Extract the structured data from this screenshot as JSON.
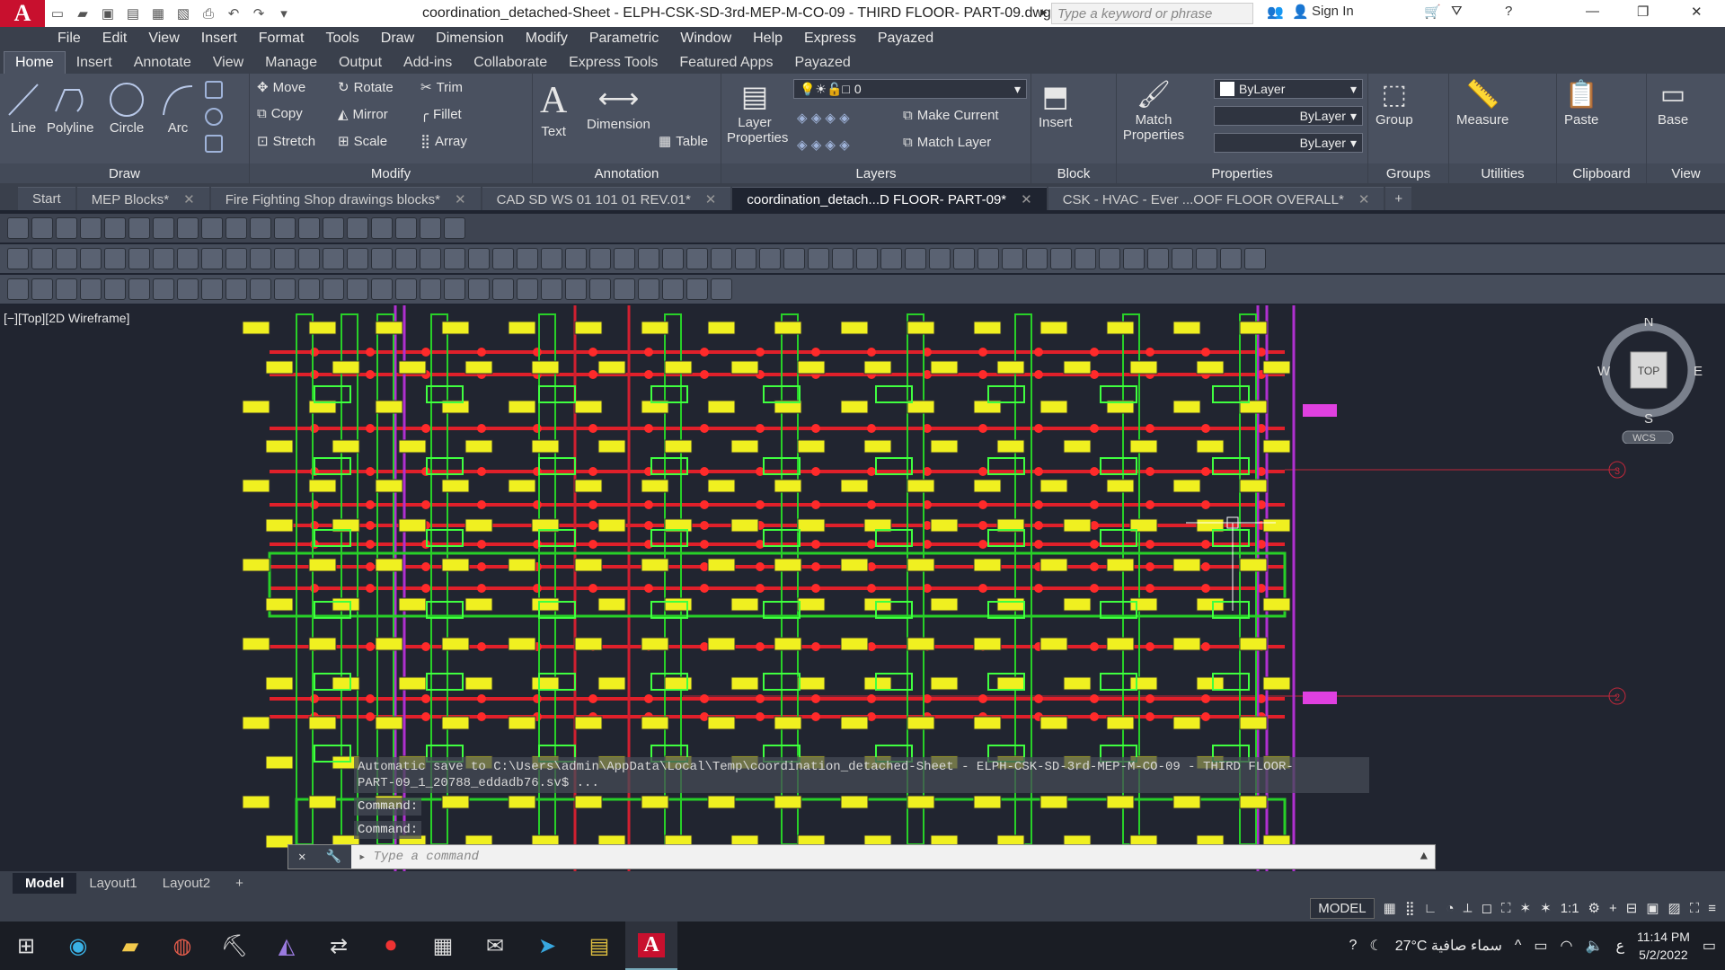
{
  "title_bar": {
    "logo": "A",
    "document_title": "coordination_detached-Sheet - ELPH-CSK-SD-3rd-MEP-M-CO-09 - THIRD  FLOOR- PART-09.dwg",
    "search_placeholder": "Type a keyword or phrase",
    "sign_in": "Sign In"
  },
  "menu": [
    "File",
    "Edit",
    "View",
    "Insert",
    "Format",
    "Tools",
    "Draw",
    "Dimension",
    "Modify",
    "Parametric",
    "Window",
    "Help",
    "Express",
    "Payazed"
  ],
  "ribbon_tabs": [
    "Home",
    "Insert",
    "Annotate",
    "View",
    "Manage",
    "Output",
    "Add-ins",
    "Collaborate",
    "Express Tools",
    "Featured Apps",
    "Payazed"
  ],
  "ribbon": {
    "draw": {
      "label": "Draw",
      "line": "Line",
      "polyline": "Polyline",
      "circle": "Circle",
      "arc": "Arc"
    },
    "modify": {
      "label": "Modify",
      "move": "Move",
      "rotate": "Rotate",
      "trim": "Trim",
      "copy": "Copy",
      "mirror": "Mirror",
      "fillet": "Fillet",
      "stretch": "Stretch",
      "scale": "Scale",
      "array": "Array"
    },
    "annotation": {
      "label": "Annotation",
      "text": "Text",
      "dimension": "Dimension",
      "table": "Table"
    },
    "layers": {
      "label": "Layers",
      "layer_properties": "Layer Properties",
      "current_layer": "0",
      "make_current": "Make Current",
      "match_layer": "Match Layer"
    },
    "block": {
      "label": "Block",
      "insert": "Insert"
    },
    "properties": {
      "label": "Properties",
      "match_properties": "Match Properties",
      "color": "ByLayer",
      "linetype": "ByLayer",
      "lineweight": "ByLayer"
    },
    "groups": {
      "label": "Groups",
      "group": "Group"
    },
    "utilities": {
      "label": "Utilities",
      "measure": "Measure"
    },
    "clipboard": {
      "label": "Clipboard",
      "paste": "Paste"
    },
    "view": {
      "label": "View",
      "base": "Base"
    }
  },
  "doc_tabs": [
    {
      "label": "Start",
      "active": false
    },
    {
      "label": "MEP Blocks*",
      "active": false
    },
    {
      "label": "Fire Fighting Shop drawings blocks*",
      "active": false
    },
    {
      "label": "CAD SD WS 01 101 01 REV.01*",
      "active": false
    },
    {
      "label": "coordination_detach...D  FLOOR- PART-09*",
      "active": true
    },
    {
      "label": "CSK - HVAC - Ever ...OOF FLOOR OVERALL*",
      "active": false
    }
  ],
  "viewport_label": "[−][Top][2D Wireframe]",
  "viewcube": {
    "n": "N",
    "s": "S",
    "e": "E",
    "w": "W",
    "top": "TOP",
    "wcs": "WCS"
  },
  "grid_bubbles": [
    "3",
    "2"
  ],
  "command": {
    "history_1": "Automatic save to C:\\Users\\admin\\AppData\\Local\\Temp\\coordination_detached-Sheet - ELPH-CSK-SD-3rd-MEP-M-CO-09 - THIRD  FLOOR-",
    "history_2": "PART-09_1_20788_eddadb76.sv$ ...",
    "line_1": "Command:",
    "line_2": "Command:",
    "placeholder": "Type a command"
  },
  "layout_tabs": [
    "Model",
    "Layout1",
    "Layout2"
  ],
  "status": {
    "model": "MODEL",
    "scale": "1:1"
  },
  "taskbar": {
    "weather": "27°C  سماء صافية",
    "lang": "ع",
    "time": "11:14 PM",
    "date": "5/2/2022"
  }
}
